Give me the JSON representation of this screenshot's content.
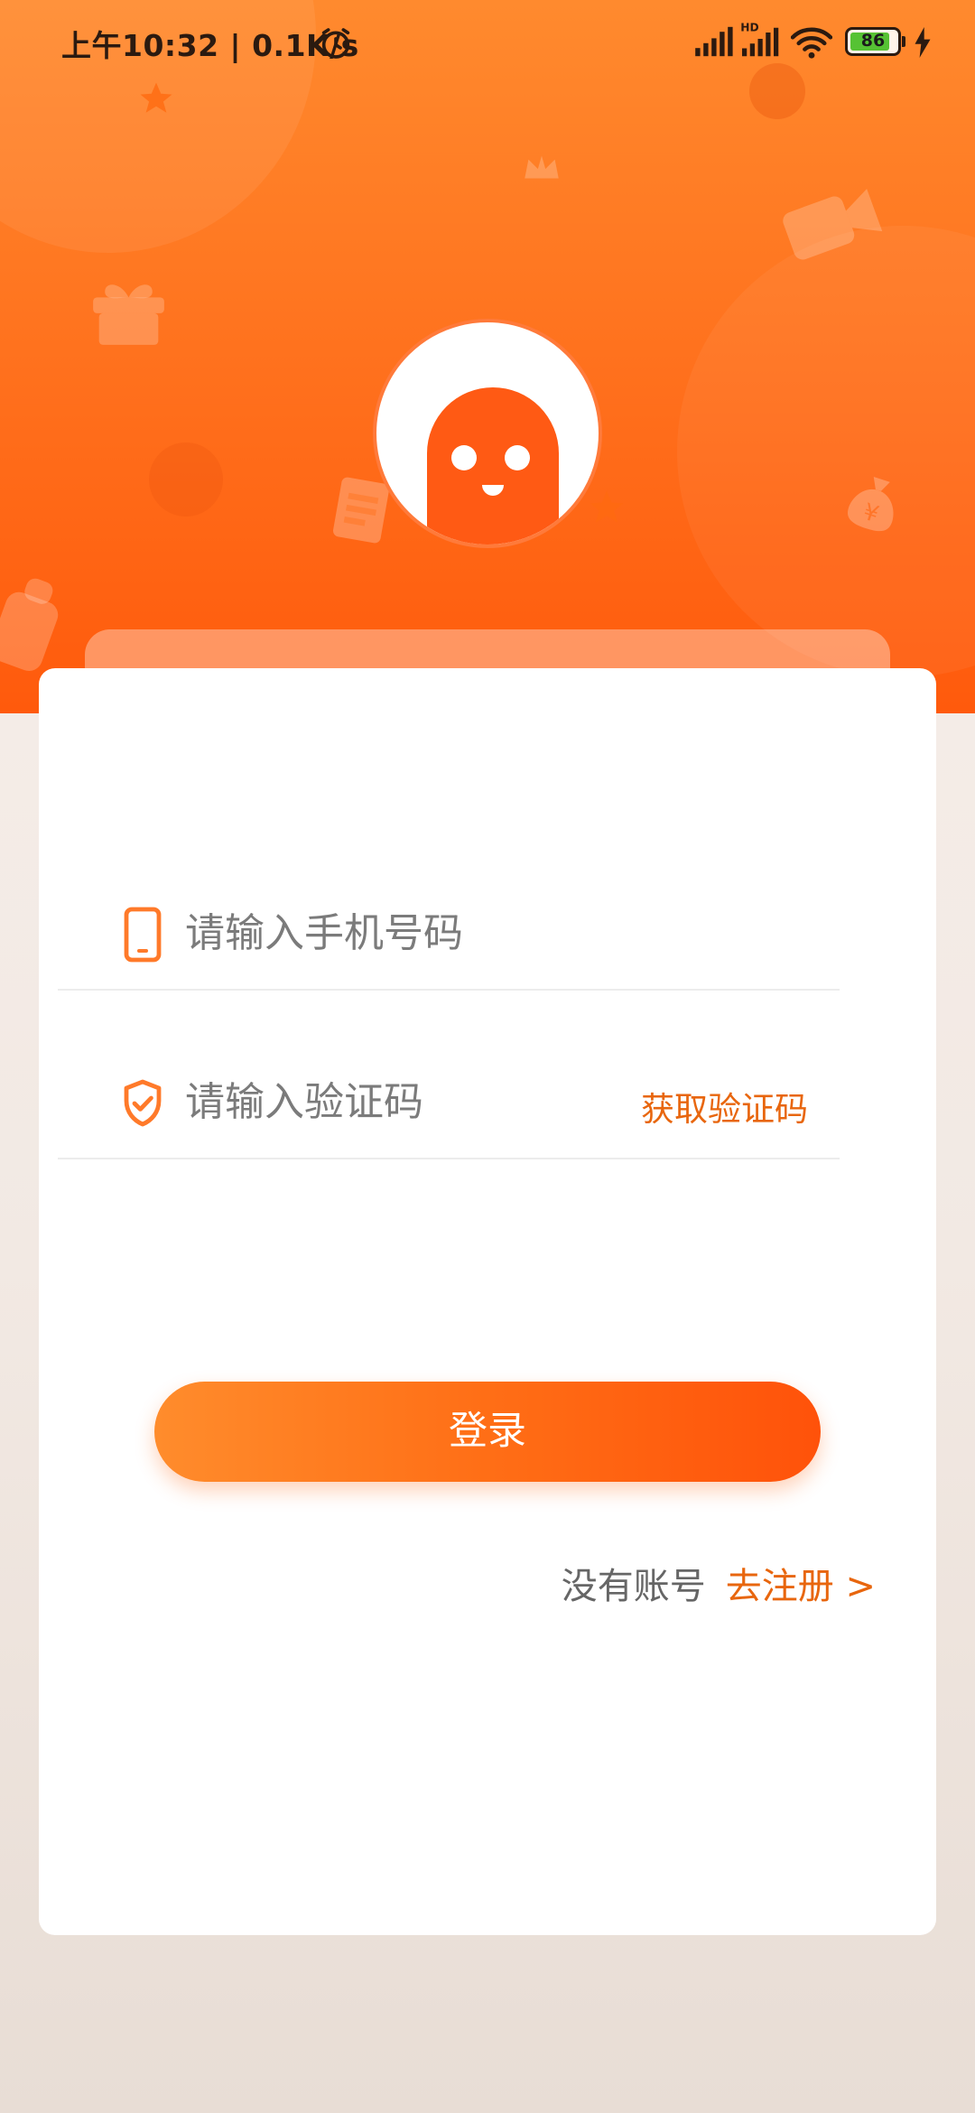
{
  "status_bar": {
    "time": "上午10:32 | 0.1K/s",
    "battery": "86",
    "battery_level": 0.86,
    "network_badge": "HD"
  },
  "theme": {
    "accent": "#ff6a14",
    "accent_text": "#e8660e",
    "header_top": "#ff8a2e",
    "header_bottom": "#ff5a0c"
  },
  "login_form": {
    "phone_placeholder": "请输入手机号码",
    "code_placeholder": "请输入验证码",
    "get_code_label": "获取验证码",
    "login_label": "登录"
  },
  "register_prompt": {
    "text": "没有账号",
    "link_label": "去注册 >"
  },
  "icons": {
    "phone_field": "phone-icon",
    "code_field": "shield-check-icon",
    "avatar": "mascot-logo"
  }
}
